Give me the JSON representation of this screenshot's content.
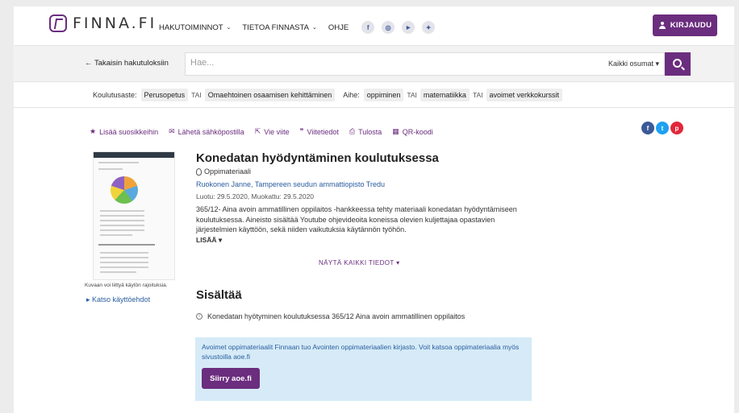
{
  "header": {
    "logo_text": "FINNA.FI",
    "nav": [
      {
        "label": "HAKUTOIMINNOT",
        "dropdown": true
      },
      {
        "label": "TIETOA FINNASTA",
        "dropdown": true
      },
      {
        "label": "OHJE",
        "dropdown": false
      }
    ],
    "social": [
      {
        "icon": "facebook-icon",
        "glyph": "f"
      },
      {
        "icon": "instagram-icon",
        "glyph": "◎"
      },
      {
        "icon": "youtube-icon",
        "glyph": "▶"
      },
      {
        "icon": "twitter-icon",
        "glyph": "✦"
      }
    ],
    "login_label": "KIRJAUDU",
    "accent_color": "#6b2d7e"
  },
  "search": {
    "back_label": "← Takaisin hakutuloksiin",
    "placeholder": "Hae...",
    "scope_label": "Kaikki osumat ▾"
  },
  "filters": {
    "level_label": "Koulutusaste:",
    "level_chips": [
      "Perusopetus",
      "Omaehtoinen osaamisen kehittäminen"
    ],
    "or_label": "TAI",
    "topic_label": "Aihe:",
    "topic_chips": [
      "oppiminen",
      "matematiikka",
      "avoimet verkkokurssit"
    ]
  },
  "toolbar": {
    "items": [
      {
        "icon": "star-icon",
        "glyph": "★",
        "label": "Lisää suosikkeihin"
      },
      {
        "icon": "envelope-icon",
        "glyph": "✉",
        "label": "Lähetä sähköpostilla"
      },
      {
        "icon": "export-icon",
        "glyph": "⇱",
        "label": "Vie viite"
      },
      {
        "icon": "quote-icon",
        "glyph": "❞",
        "label": "Viitetiedot"
      },
      {
        "icon": "print-icon",
        "glyph": "⎙",
        "label": "Tulosta"
      },
      {
        "icon": "qr-code-icon",
        "glyph": "▦",
        "label": "QR-koodi"
      }
    ],
    "share": [
      {
        "icon": "facebook-share-icon",
        "glyph": "f",
        "color": "#3b5998"
      },
      {
        "icon": "twitter-share-icon",
        "glyph": "t",
        "color": "#1da1f2"
      },
      {
        "icon": "pinterest-share-icon",
        "glyph": "p",
        "color": "#e3263a"
      }
    ]
  },
  "side": {
    "image_notice": "Kuvaan voi liittyä käytön rajoituksia.",
    "terms_link": "▸ Katso käyttöehdot"
  },
  "record": {
    "title": "Konedatan hyödyntäminen koulutuksessa",
    "format": "Oppimateriaali",
    "authors": "Ruokonen Janne, Tampereen seudun ammattiopisto Tredu",
    "dates": "Luotu: 29.5.2020, Muokattu: 29.5.2020",
    "description": "365/12- Aina avoin ammatillinen oppilaitos -hankkeessa tehty materiaali konedatan hyödyntämiseen koulutuksessa. Aineisto sisältää Youtube ohjevideoita koneissa olevien kuljettajaa opastavien järjestelmien käyttöön, sekä niiden vaikutuksia käytännön työhön.",
    "more_label": "LISÄÄ ▾",
    "show_all_label": "NÄYTÄ KAIKKI TIEDOT ▾"
  },
  "contains": {
    "title": "Sisältää",
    "item": "Konedatan hyötyminen koulutuksessa 365/12 Aina avoin ammatillinen oppilaitos"
  },
  "notice": {
    "text": "Avoimet oppimateriaalit Finnaan tuo Avointen oppimateriaalien kirjasto. Voit katsoa oppimateriaalia myös sivustoilla aoe.fi",
    "button_label": "Siirry aoe.fi"
  }
}
